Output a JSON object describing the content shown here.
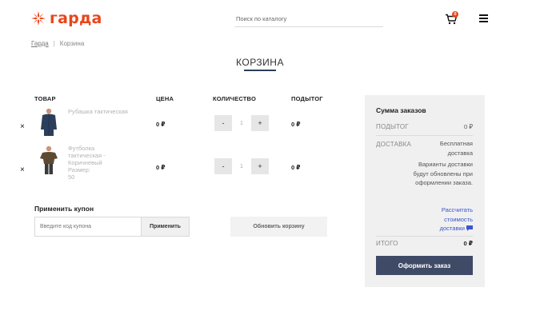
{
  "header": {
    "logo_text": "гарда",
    "search_placeholder": "Поиск по каталогу",
    "cart_count": "0"
  },
  "breadcrumb": {
    "home": "Гарда",
    "separator": "|",
    "current": "Корзина"
  },
  "page_title": "КОРЗИНА",
  "table": {
    "headers": {
      "product": "ТОВАР",
      "price": "ЦЕНА",
      "quantity": "КОЛИЧЕСТВО",
      "subtotal": "ПОДЫТОГ"
    },
    "rows": [
      {
        "name": "Рубашка тактическая",
        "price": "0 ₽",
        "qty": "1",
        "subtotal": "0 ₽",
        "remove": "×",
        "minus": "-",
        "plus": "+"
      },
      {
        "name": "Футболка тактическая - Коричневый",
        "variant_label": "Размер:",
        "variant_value": "50",
        "price": "0 ₽",
        "qty": "1",
        "subtotal": "0 ₽",
        "remove": "×",
        "minus": "-",
        "plus": "+"
      }
    ]
  },
  "coupon": {
    "title": "Применить купон",
    "placeholder": "Введите код купона",
    "apply_label": "Применить"
  },
  "update_cart_label": "Обновить корзину",
  "summary": {
    "title": "Сумма заказов",
    "subtotal_label": "ПОДЫТОГ",
    "subtotal_value": "0 ₽",
    "shipping_label": "ДОСТАВКА",
    "shipping_value": "Бесплатная доставка",
    "shipping_note": "Варианты доставки будут обновлены при оформлении заказа.",
    "calc_link": "Рассчитать стоимость доставки",
    "total_label": "ИТОГО",
    "total_value": "0 ₽",
    "checkout_label": "Оформить заказ"
  },
  "colors": {
    "brand": "#e8461c",
    "checkout": "#3e4a66",
    "link": "#3b55d0"
  }
}
